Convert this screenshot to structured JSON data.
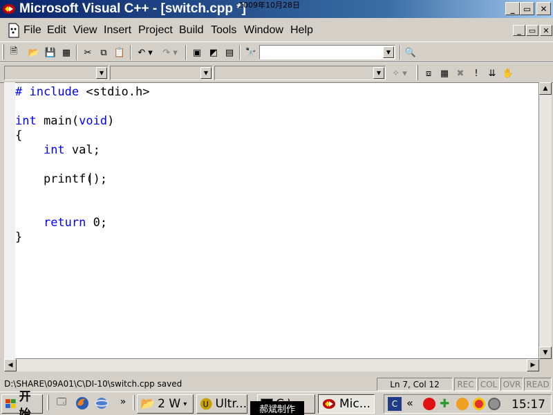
{
  "window": {
    "title": "Microsoft Visual C++ - [switch.cpp *]",
    "date_overlay": "2009年10月28日",
    "minimize": "_",
    "maximize": "▭",
    "close": "✕"
  },
  "menu": {
    "items": [
      "File",
      "Edit",
      "View",
      "Insert",
      "Project",
      "Build",
      "Tools",
      "Window",
      "Help"
    ]
  },
  "toolbar": {
    "find_value": ""
  },
  "editor": {
    "lines": [
      "# include <stdio.h>",
      "",
      "int main(void)",
      "{",
      "    int val;",
      "",
      "    printf();",
      "",
      "",
      "    return 0;",
      "}"
    ]
  },
  "status": {
    "message": "D:\\SHARE\\09A01\\C\\DI-10\\switch.cpp saved",
    "position": "Ln 7, Col 12",
    "rec": "REC",
    "col": "COL",
    "ovr": "OVR",
    "read": "READ"
  },
  "taskbar": {
    "start_label": "开始",
    "buttons": [
      "2 W",
      "Ultr...",
      "C:\\...",
      "Mic..."
    ],
    "clock": "15:17",
    "overlay_caption": "郝斌制作"
  }
}
